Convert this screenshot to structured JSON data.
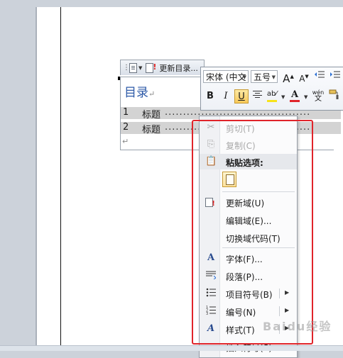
{
  "toc_control": {
    "update_button": "更新目录...",
    "title": "目录",
    "paragraph_mark": "↵",
    "entries": [
      {
        "number": "1",
        "text": "标题",
        "leader": "........................................"
      },
      {
        "number": "2",
        "text": "标题",
        "leader": "........................................"
      }
    ],
    "end_mark": "↵"
  },
  "mini_toolbar": {
    "font_name": "宋体 (中文",
    "font_size": "五号",
    "grow_font": "A",
    "shrink_font": "A",
    "bold": "B",
    "italic": "I",
    "underline": "U",
    "highlight_color": "#f7e31a",
    "font_color": "#e0242a",
    "pinyin": "wén"
  },
  "context_menu": {
    "items": [
      {
        "label": "剪切(T)",
        "icon": "scissors-icon",
        "disabled": true
      },
      {
        "label": "复制(C)",
        "icon": "copy-icon",
        "disabled": true
      },
      {
        "label": "粘贴选项:",
        "icon": "paste-icon",
        "header": true
      },
      {
        "label": "更新域(U)",
        "icon": "update-field-icon"
      },
      {
        "label": "编辑域(E)...",
        "icon": ""
      },
      {
        "label": "切换域代码(T)",
        "icon": ""
      },
      {
        "label": "字体(F)...",
        "icon": "font-icon"
      },
      {
        "label": "段落(P)...",
        "icon": "paragraph-icon"
      },
      {
        "label": "项目符号(B)",
        "icon": "bullets-icon",
        "submenu": true
      },
      {
        "label": "编号(N)",
        "icon": "numbering-icon",
        "submenu": true
      },
      {
        "label": "样式(T)",
        "icon": "styles-icon",
        "submenu": true
      },
      {
        "label": "插入符号(S)",
        "icon": ""
      }
    ]
  },
  "colors": {
    "highlight_border": "#e0242a",
    "toc_title": "#2d5aa8"
  }
}
